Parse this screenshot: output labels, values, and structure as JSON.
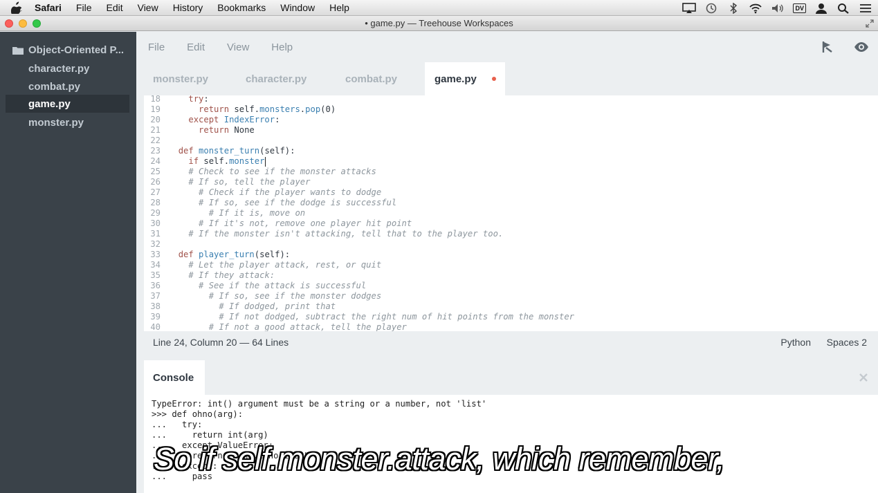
{
  "menubar": {
    "items": [
      "Safari",
      "File",
      "Edit",
      "View",
      "History",
      "Bookmarks",
      "Window",
      "Help"
    ],
    "tray_icons": [
      "airplay-icon",
      "time-machine-icon",
      "bluetooth-icon",
      "wifi-icon",
      "volume-icon",
      "dv-badge",
      "user-icon",
      "spotlight-icon",
      "notification-center-icon"
    ],
    "dv_label": "DV"
  },
  "window": {
    "title": "• game.py — Treehouse Workspaces"
  },
  "sidebar": {
    "folder": "Object-Oriented P...",
    "files": [
      "character.py",
      "combat.py",
      "game.py",
      "monster.py"
    ],
    "active_file": "game.py"
  },
  "editor": {
    "menu": [
      "File",
      "Edit",
      "View",
      "Help"
    ],
    "tabs": [
      {
        "label": "monster.py",
        "active": false
      },
      {
        "label": "character.py",
        "active": false
      },
      {
        "label": "combat.py",
        "active": false
      },
      {
        "label": "game.py",
        "active": true,
        "dirty": true
      }
    ],
    "lines": [
      {
        "n": "18",
        "indent": "    ",
        "tokens": [
          [
            "kw",
            "try"
          ],
          [
            "",
            ":"
          ]
        ]
      },
      {
        "n": "19",
        "indent": "      ",
        "tokens": [
          [
            "kw",
            "return"
          ],
          [
            "",
            " self."
          ],
          [
            "nm",
            "monsters"
          ],
          [
            "",
            "."
          ],
          [
            "nm",
            "pop"
          ],
          [
            "",
            "(0)"
          ]
        ]
      },
      {
        "n": "20",
        "indent": "    ",
        "tokens": [
          [
            "kw",
            "except"
          ],
          [
            "",
            " "
          ],
          [
            "nm",
            "IndexError"
          ],
          [
            "",
            ":"
          ]
        ]
      },
      {
        "n": "21",
        "indent": "      ",
        "tokens": [
          [
            "kw",
            "return"
          ],
          [
            "",
            " None"
          ]
        ]
      },
      {
        "n": "22",
        "indent": "",
        "tokens": []
      },
      {
        "n": "23",
        "indent": "  ",
        "tokens": [
          [
            "kw",
            "def"
          ],
          [
            "",
            " "
          ],
          [
            "nm",
            "monster_turn"
          ],
          [
            "",
            "(self):"
          ]
        ]
      },
      {
        "n": "24",
        "indent": "    ",
        "tokens": [
          [
            "kw",
            "if"
          ],
          [
            "",
            " self."
          ],
          [
            "nm",
            "monster"
          ]
        ],
        "cursor": true
      },
      {
        "n": "25",
        "indent": "    ",
        "tokens": [
          [
            "cm",
            "# Check to see if the monster attacks"
          ]
        ]
      },
      {
        "n": "26",
        "indent": "    ",
        "tokens": [
          [
            "cm",
            "# If so, tell the player"
          ]
        ]
      },
      {
        "n": "27",
        "indent": "      ",
        "tokens": [
          [
            "cm",
            "# Check if the player wants to dodge"
          ]
        ]
      },
      {
        "n": "28",
        "indent": "      ",
        "tokens": [
          [
            "cm",
            "# If so, see if the dodge is successful"
          ]
        ]
      },
      {
        "n": "29",
        "indent": "        ",
        "tokens": [
          [
            "cm",
            "# If it is, move on"
          ]
        ]
      },
      {
        "n": "30",
        "indent": "      ",
        "tokens": [
          [
            "cm",
            "# If it's not, remove one player hit point"
          ]
        ]
      },
      {
        "n": "31",
        "indent": "    ",
        "tokens": [
          [
            "cm",
            "# If the monster isn't attacking, tell that to the player too."
          ]
        ]
      },
      {
        "n": "32",
        "indent": "",
        "tokens": []
      },
      {
        "n": "33",
        "indent": "  ",
        "tokens": [
          [
            "kw",
            "def"
          ],
          [
            "",
            " "
          ],
          [
            "nm",
            "player_turn"
          ],
          [
            "",
            "(self):"
          ]
        ]
      },
      {
        "n": "34",
        "indent": "    ",
        "tokens": [
          [
            "cm",
            "# Let the player attack, rest, or quit"
          ]
        ]
      },
      {
        "n": "35",
        "indent": "    ",
        "tokens": [
          [
            "cm",
            "# If they attack:"
          ]
        ]
      },
      {
        "n": "36",
        "indent": "      ",
        "tokens": [
          [
            "cm",
            "# See if the attack is successful"
          ]
        ]
      },
      {
        "n": "37",
        "indent": "        ",
        "tokens": [
          [
            "cm",
            "# If so, see if the monster dodges"
          ]
        ]
      },
      {
        "n": "38",
        "indent": "          ",
        "tokens": [
          [
            "cm",
            "# If dodged, print that"
          ]
        ]
      },
      {
        "n": "39",
        "indent": "          ",
        "tokens": [
          [
            "cm",
            "# If not dodged, subtract the right num of hit points from the monster"
          ]
        ]
      },
      {
        "n": "40",
        "indent": "        ",
        "tokens": [
          [
            "cm",
            "# If not a good attack, tell the player"
          ]
        ]
      }
    ],
    "status": {
      "position": "Line 24, Column 20 — 64 Lines",
      "language": "Python",
      "spaces": "Spaces  2"
    }
  },
  "console": {
    "tab_label": "Console",
    "lines": [
      "TypeError: int() argument must be a string or a number, not 'list'",
      ">>> def ohno(arg):",
      "...   try:",
      "...     return int(arg)",
      "...   except ValueError:",
      "...     return \"I have no idea\"",
      "...   except:",
      "...     pass"
    ]
  },
  "subtitle": "So if self.monster.attack, which remember,"
}
